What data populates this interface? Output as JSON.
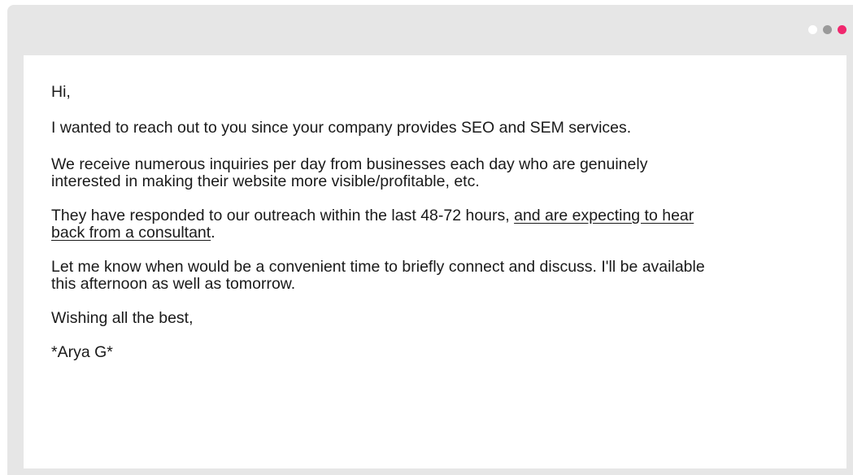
{
  "window": {
    "dots": [
      {
        "name": "dot-white",
        "color": "#ffffff"
      },
      {
        "name": "dot-gray",
        "color": "#9a9a9a"
      },
      {
        "name": "dot-pink",
        "color": "#f0286e"
      }
    ]
  },
  "email": {
    "greeting": "Hi,",
    "intro": "I wanted to reach out to you since your company provides SEO and SEM services.",
    "inquiries": "We receive numerous inquiries per day from businesses each day who are genuinely\ninterested in making their website more visible/profitable, etc.",
    "responded_plain": "They have responded to our outreach within the last 48-72 hours, ",
    "responded_underlined": "and are expecting to hear\nback from a consultant",
    "responded_end": ".",
    "request": "Let me know when would be a convenient time to briefly connect and discuss. I'll be available\nthis afternoon as well as tomorrow.",
    "closing": "Wishing all the best,",
    "signature": "*Arya G*"
  }
}
